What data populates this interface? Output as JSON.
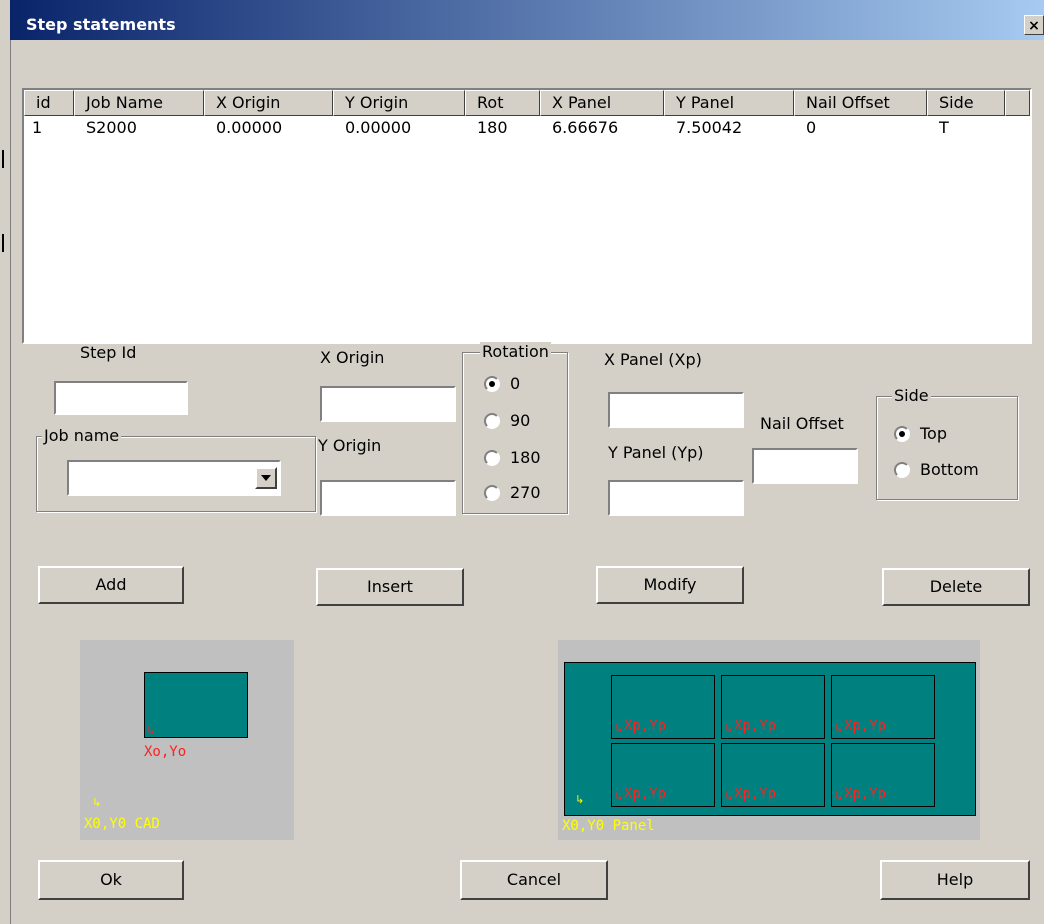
{
  "window": {
    "title": "Step statements",
    "close_glyph": "×"
  },
  "table": {
    "columns": [
      "id",
      "Job Name",
      "X Origin",
      "Y Origin",
      "Rot",
      "X Panel",
      "Y Panel",
      "Nail Offset",
      "Side"
    ],
    "rows": [
      [
        "1",
        "S2000",
        "0.00000",
        "0.00000",
        "180",
        "6.66676",
        "7.50042",
        "0",
        "T"
      ]
    ]
  },
  "form": {
    "step_id_label": "Step Id",
    "step_id_value": "",
    "job_name_group": "Job name",
    "job_name_value": "",
    "x_origin_label": "X Origin",
    "x_origin_value": "",
    "y_origin_label": "Y Origin",
    "y_origin_value": "",
    "rotation_group": "Rotation",
    "rotation_options": [
      "0",
      "90",
      "180",
      "270"
    ],
    "rotation_selected": "0",
    "x_panel_label": "X Panel (Xp)",
    "x_panel_value": "",
    "y_panel_label": "Y Panel (Yp)",
    "y_panel_value": "",
    "nail_offset_label": "Nail Offset",
    "nail_offset_value": "",
    "side_group": "Side",
    "side_options": [
      "Top",
      "Bottom"
    ],
    "side_selected": "Top"
  },
  "buttons": {
    "add": "Add",
    "insert": "Insert",
    "modify": "Modify",
    "delete": "Delete",
    "ok": "Ok",
    "cancel": "Cancel",
    "help": "Help"
  },
  "diagrams": {
    "cad": {
      "inner_label": "Xo,Yo",
      "origin_label": "X0,Y0 CAD"
    },
    "panel": {
      "cell_label": "Xp,Yp",
      "origin_label": "X0,Y0 Panel"
    }
  },
  "colors": {
    "teal": "#00807f",
    "label_red": "#ff2020",
    "label_yellow": "#ffff00",
    "diagram_bg": "#c0c0c0"
  }
}
